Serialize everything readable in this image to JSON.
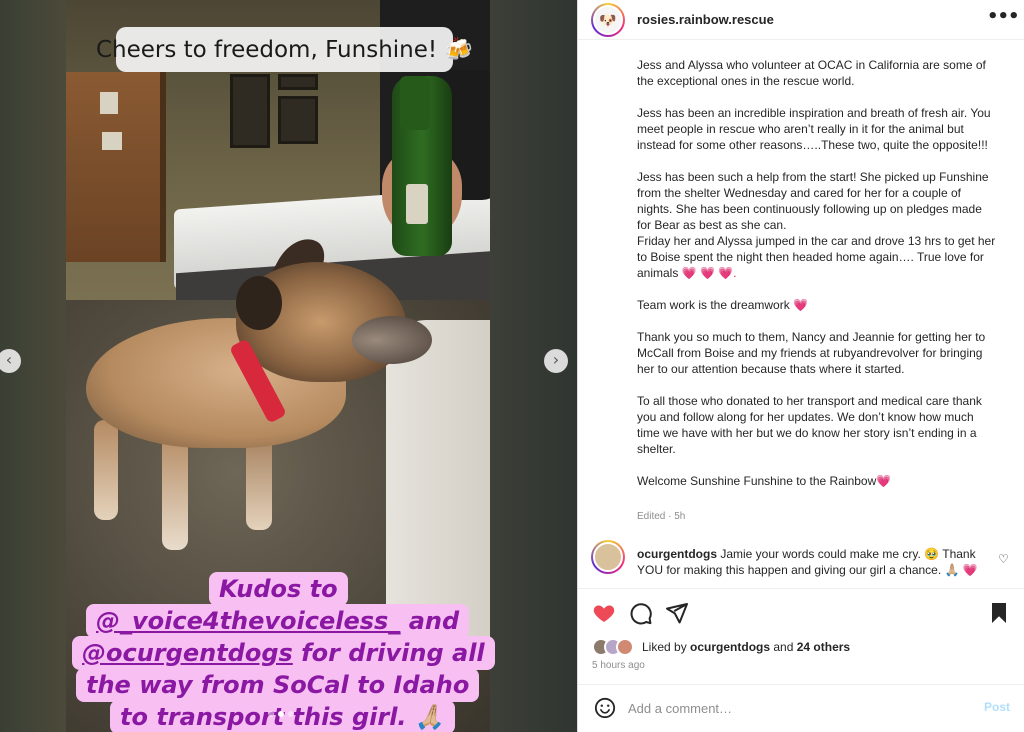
{
  "media": {
    "caption_top": "Cheers to freedom, Funshine! 🍻",
    "caption_bottom": {
      "line1": "Kudos to",
      "line2_user": "@_voice4thevoiceless_",
      "line2_rest": " and",
      "line3_user": "@ocurgentdogs",
      "line3_rest": " for driving all",
      "line4": "the way from SoCal to Idaho",
      "line5": "to transport this girl. 🙏🏼"
    },
    "prev_glyph": "‹",
    "next_glyph": "›"
  },
  "post": {
    "username": "rosies.rainbow.rescue",
    "more_glyph": "•••",
    "avatar_glyph": "🐶",
    "caption": {
      "p1": "Jess and Alyssa who volunteer at OCAC in California are some of the exceptional ones in the rescue world.",
      "p2": "Jess has been an incredible inspiration and breath of fresh air. You meet people in rescue who aren’t really in it for the animal but instead for some other reasons…..These two, quite the opposite!!!",
      "p3a": "Jess has been such a help from the start! She picked up Funshine from the shelter Wednesday and cared for her for a couple of nights. She has been continuously following up on pledges made for Bear as best as she can.",
      "p3b": "Friday her and Alyssa jumped in the car and drove 13 hrs to get her to Boise spent the night then headed home again…. True love for animals",
      "p3_emoji": " 💗 💗 💗.",
      "p4": "Team work is the dreamwork",
      "p4_emoji": " 💗",
      "p5": "Thank you so much to them, Nancy and Jeannie for getting her to McCall from Boise and my friends at rubyandrevolver for bringing her to our attention because thats where it started.",
      "p6": "To all those who donated to her transport and medical care thank you and follow along for her updates. We don’t know how much time we have with her but we do know her story isn’t ending in a shelter.",
      "p7": "Welcome Sunshine Funshine to the Rainbow",
      "p7_emoji": "💗"
    },
    "edited": "Edited · 5h"
  },
  "comment": {
    "username": "ocurgentdogs",
    "text": " Jamie your words could make me cry. 🥹 Thank YOU for making this happen and giving our girl a chance. 🙏🏼 💗",
    "heart_glyph": "♡"
  },
  "engagement": {
    "liked_by_prefix": "Liked by ",
    "liked_by_user": "ocurgentdogs",
    "liked_by_mid": " and ",
    "liked_by_others": "24 others",
    "time": "5 hours ago"
  },
  "add_comment": {
    "placeholder": "Add a comment…",
    "post_label": "Post"
  },
  "colors": {
    "like_red": "#ed4956",
    "post_blue_disabled": "#b2dffc",
    "caption_pink_bg": "#f7bff2",
    "caption_purple": "#8a18a3"
  },
  "icons": [
    "heart-icon",
    "comment-icon",
    "share-icon",
    "bookmark-icon",
    "smiley-icon",
    "more-icon"
  ]
}
